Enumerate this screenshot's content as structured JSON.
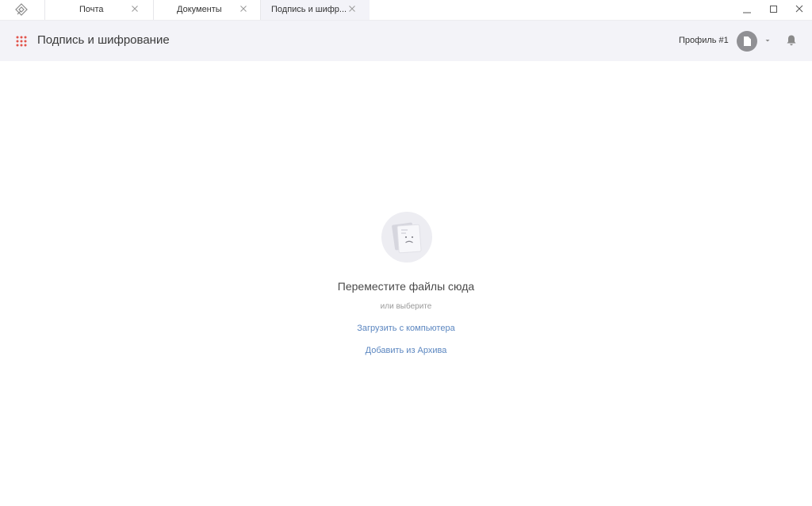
{
  "titlebar": {
    "tabs": [
      {
        "label": "Почта",
        "active": false
      },
      {
        "label": "Документы",
        "active": false
      },
      {
        "label": "Подпись и шифр...",
        "active": true
      }
    ],
    "window_controls": [
      "minimize-icon",
      "maximize-icon",
      "close-icon"
    ]
  },
  "header": {
    "title": "Подпись и шифрование",
    "profile_label": "Профиль #1",
    "icons": [
      "apps-grid-icon",
      "avatar",
      "chevron-down-icon",
      "bell-icon"
    ]
  },
  "dropzone": {
    "title": "Переместите файлы сюда",
    "or_text": "или выберите",
    "upload_link": "Загрузить с компьютера",
    "archive_link": "Добавить из Архива",
    "illustration": "sad-document-icon"
  },
  "colors": {
    "header_bg": "#f3f3f8",
    "link": "#5b86c0",
    "apps_icon": "#e2534a",
    "avatar": "#909094"
  }
}
